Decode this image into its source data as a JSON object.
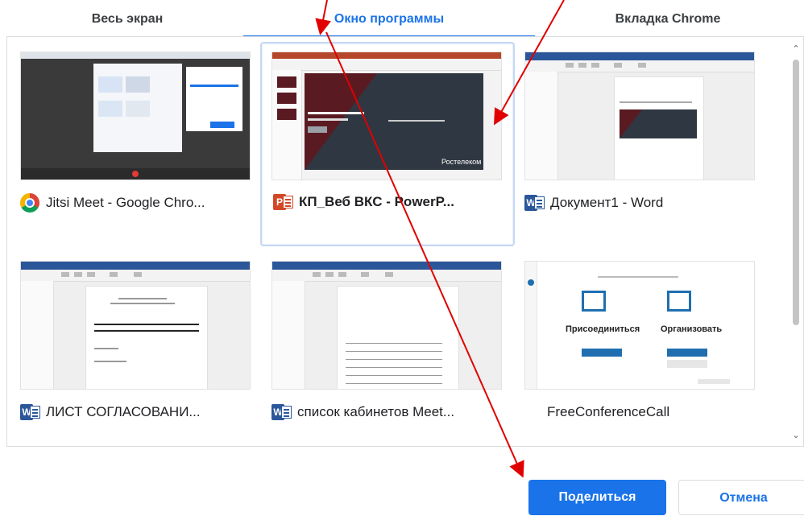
{
  "tabs": [
    {
      "label": "Весь экран"
    },
    {
      "label": "Окно программы"
    },
    {
      "label": "Вкладка Chrome"
    }
  ],
  "windows": [
    {
      "title": "Jitsi Meet - Google Chro...",
      "app_icon": "chrome-icon"
    },
    {
      "title": "КП_Веб ВКС - PowerP...",
      "app_icon": "powerpoint-icon"
    },
    {
      "title": "Документ1 - Word",
      "app_icon": "word-icon"
    },
    {
      "title": "ЛИСТ СОГЛАСОВАНИ...",
      "app_icon": "word-icon"
    },
    {
      "title": "список кабинетов Meet...",
      "app_icon": "word-icon"
    },
    {
      "title": "FreeConferenceCall",
      "app_icon": ""
    }
  ],
  "thumb_text": {
    "ppt_slide_footer": "Ростелеком",
    "fcc_join": "Присоединиться",
    "fcc_host": "Организовать"
  },
  "buttons": {
    "share": "Поделиться",
    "cancel": "Отмена"
  },
  "colors": {
    "accent": "#1a73e8",
    "arrow": "#e00000",
    "slide_maroon": "#5a1a22",
    "slide_dark": "#2f3742",
    "fcc_blue": "#1f6fb0"
  }
}
